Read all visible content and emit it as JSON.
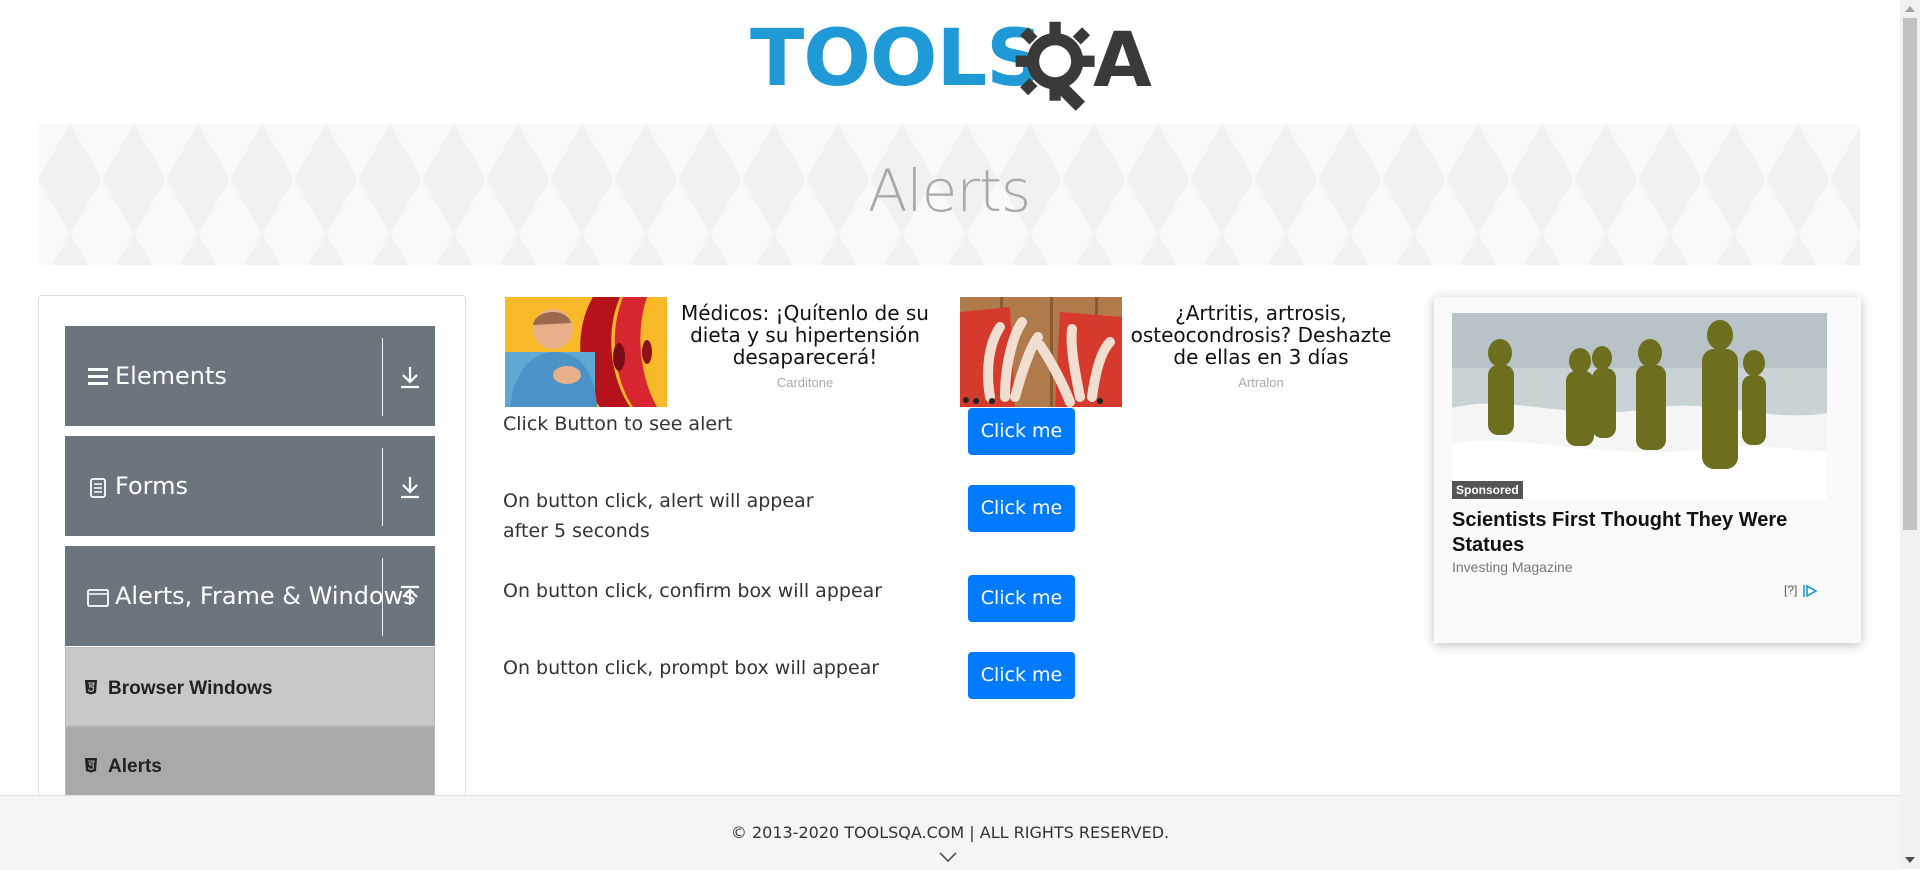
{
  "header": {
    "logo_part1": "TOOLS",
    "logo_part2": "A",
    "logo_colors": {
      "tools": "#1f9ad6",
      "qa": "#3a3a3a"
    }
  },
  "banner": {
    "title": "Alerts"
  },
  "sidebar": {
    "groups": [
      {
        "label": "Elements",
        "icon": "hamburger-icon",
        "state": "collapsed"
      },
      {
        "label": "Forms",
        "icon": "document-icon",
        "state": "collapsed"
      },
      {
        "label": "Alerts, Frame & Windows",
        "icon": "window-icon",
        "state": "expanded"
      }
    ],
    "items": [
      {
        "label": "Browser Windows",
        "icon": "html5-icon"
      },
      {
        "label": "Alerts",
        "icon": "html5-icon",
        "active": true
      }
    ]
  },
  "ads": [
    {
      "title": "Médicos: ¡Quítenlo de su dieta y su hipertensión desaparecerá!",
      "source": "Carditone"
    },
    {
      "title": "¿Artritis, artrosis, osteocondrosis? Deshazte de ellas en 3 días",
      "source": "Artralon"
    }
  ],
  "alerts": [
    {
      "label": "Click Button to see alert",
      "button": "Click me"
    },
    {
      "label": "On button click, alert will appear after 5 seconds",
      "button": "Click me"
    },
    {
      "label": "On button click, confirm box will appear",
      "button": "Click me"
    },
    {
      "label": "On button click, prompt box will appear",
      "button": "Click me"
    }
  ],
  "sponsored_ad": {
    "badge": "Sponsored",
    "title": "Scientists First Thought They Were Statues",
    "source": "Investing Magazine",
    "adchoices": "[?]"
  },
  "footer": {
    "copyright": "© 2013-2020 TOOLSQA.COM | ALL RIGHTS RESERVED."
  },
  "colors": {
    "button": "#007bff",
    "sidebar_group": "#6c757d",
    "item_bg": "#c8c8c8",
    "item_active_bg": "#a9a9a9"
  }
}
